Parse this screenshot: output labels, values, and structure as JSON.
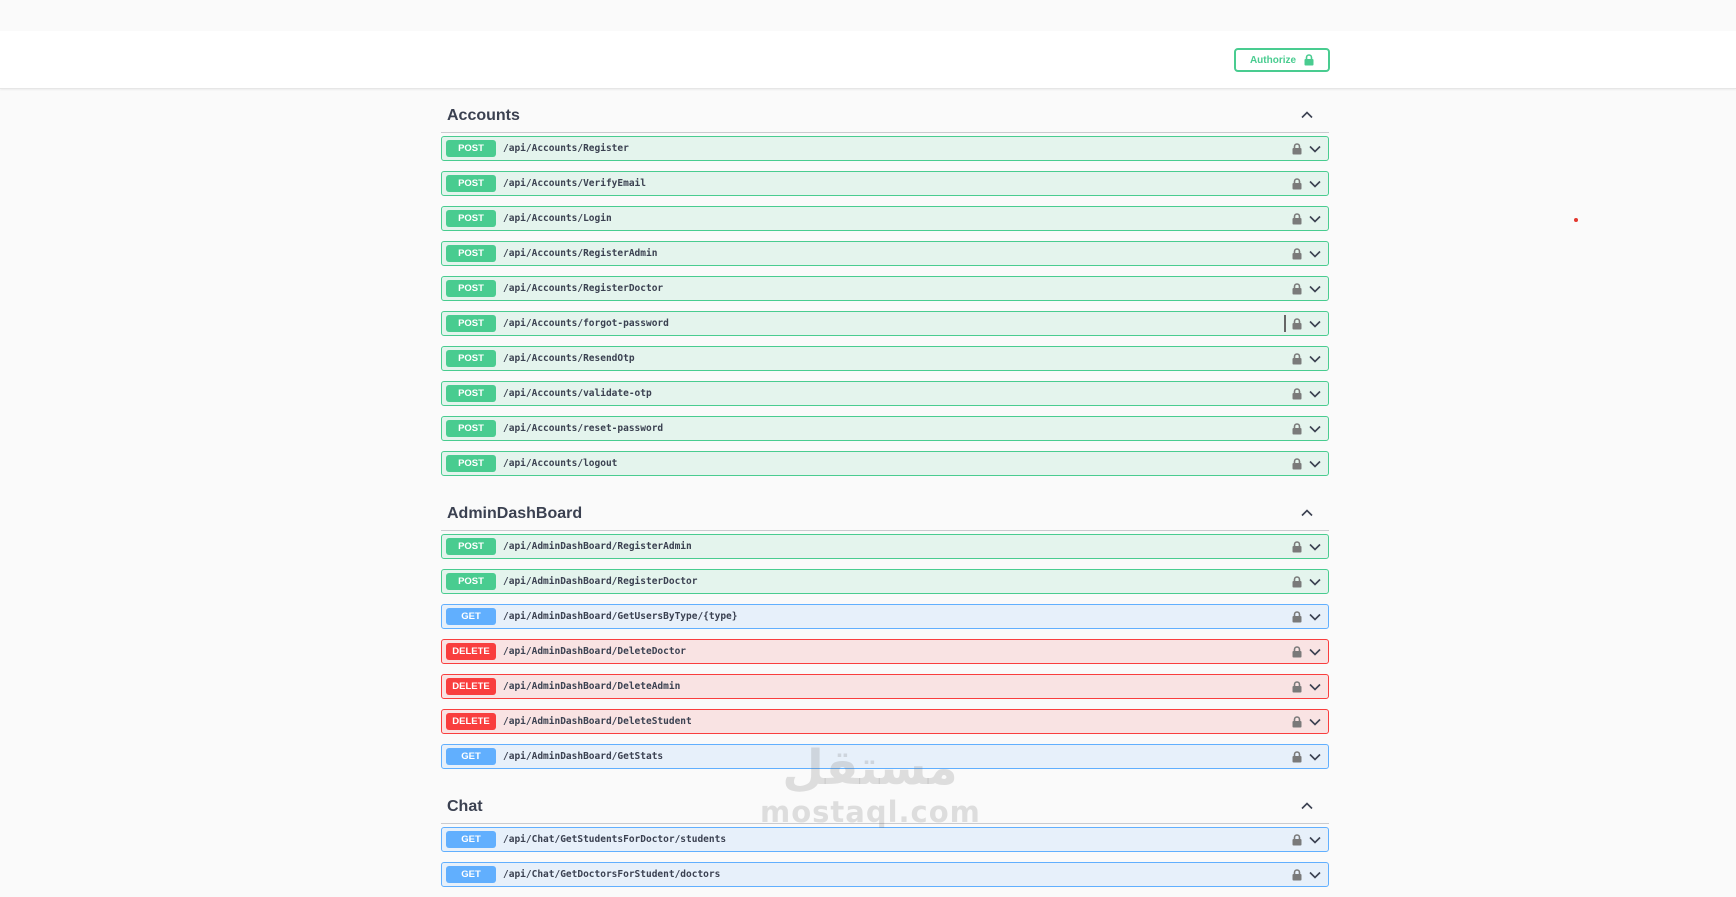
{
  "authorize": {
    "label": "Authorize",
    "icon": "lock-icon",
    "color": "#49cc90"
  },
  "colors": {
    "post": "#49cc90",
    "get": "#61affe",
    "delete": "#f93e3e",
    "text": "#3b4151"
  },
  "sections": [
    {
      "title": "Accounts",
      "expanded": true,
      "operations": [
        {
          "method": "POST",
          "path": "/api/Accounts/Register"
        },
        {
          "method": "POST",
          "path": "/api/Accounts/VerifyEmail"
        },
        {
          "method": "POST",
          "path": "/api/Accounts/Login"
        },
        {
          "method": "POST",
          "path": "/api/Accounts/RegisterAdmin"
        },
        {
          "method": "POST",
          "path": "/api/Accounts/RegisterDoctor"
        },
        {
          "method": "POST",
          "path": "/api/Accounts/forgot-password"
        },
        {
          "method": "POST",
          "path": "/api/Accounts/ResendOtp"
        },
        {
          "method": "POST",
          "path": "/api/Accounts/validate-otp"
        },
        {
          "method": "POST",
          "path": "/api/Accounts/reset-password"
        },
        {
          "method": "POST",
          "path": "/api/Accounts/logout"
        }
      ]
    },
    {
      "title": "AdminDashBoard",
      "expanded": true,
      "operations": [
        {
          "method": "POST",
          "path": "/api/AdminDashBoard/RegisterAdmin"
        },
        {
          "method": "POST",
          "path": "/api/AdminDashBoard/RegisterDoctor"
        },
        {
          "method": "GET",
          "path": "/api/AdminDashBoard/GetUsersByType/{type}"
        },
        {
          "method": "DELETE",
          "path": "/api/AdminDashBoard/DeleteDoctor"
        },
        {
          "method": "DELETE",
          "path": "/api/AdminDashBoard/DeleteAdmin"
        },
        {
          "method": "DELETE",
          "path": "/api/AdminDashBoard/DeleteStudent"
        },
        {
          "method": "GET",
          "path": "/api/AdminDashBoard/GetStats"
        }
      ]
    },
    {
      "title": "Chat",
      "expanded": true,
      "operations": [
        {
          "method": "GET",
          "path": "/api/Chat/GetStudentsForDoctor/students"
        },
        {
          "method": "GET",
          "path": "/api/Chat/GetDoctorsForStudent/doctors"
        }
      ]
    }
  ],
  "watermark": {
    "arabic": "مستقل",
    "latin": "mostaql.com"
  }
}
